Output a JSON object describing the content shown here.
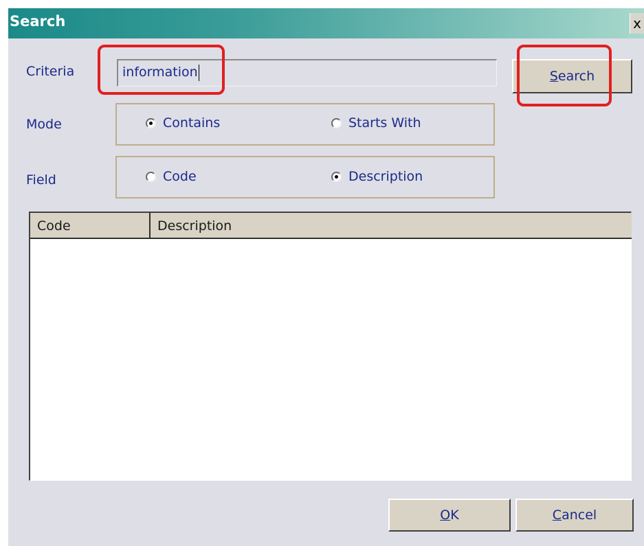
{
  "window": {
    "title": "Search",
    "close_label": "x"
  },
  "criteria": {
    "label": "Criteria",
    "value": "information",
    "search_button": "Search",
    "search_mnemonic": "S",
    "search_rest": "earch"
  },
  "mode": {
    "label": "Mode",
    "options": [
      {
        "label": "Contains",
        "selected": true
      },
      {
        "label": "Starts With",
        "selected": false
      }
    ]
  },
  "field": {
    "label": "Field",
    "options": [
      {
        "label": "Code",
        "selected": false
      },
      {
        "label": "Description",
        "selected": true
      }
    ]
  },
  "results": {
    "columns": [
      "Code",
      "Description"
    ],
    "rows": []
  },
  "footer": {
    "ok_mnemonic": "O",
    "ok_rest": "K",
    "cancel_mnemonic": "C",
    "cancel_rest": "ancel"
  },
  "colors": {
    "title_bar": "#1a8a88",
    "label_text": "#1a2a8a",
    "annotation": "#e02020",
    "dialog_bg": "#dedee6"
  }
}
